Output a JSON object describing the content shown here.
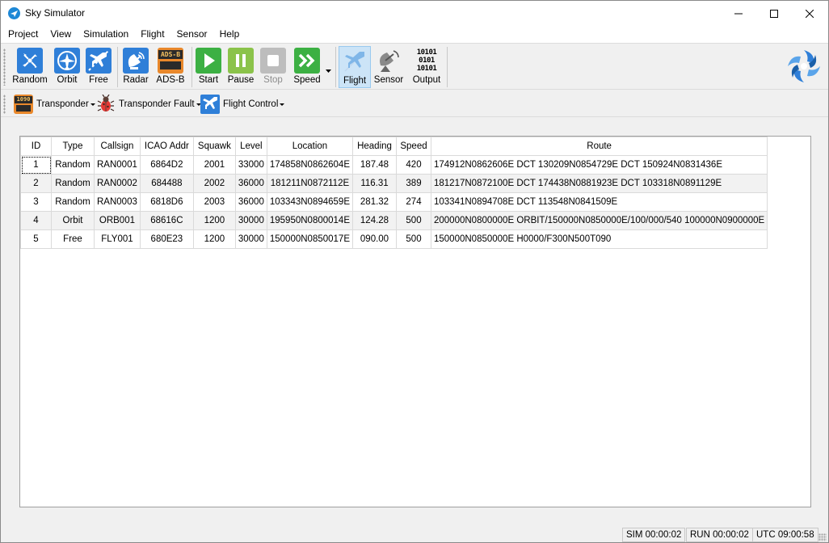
{
  "window": {
    "title": "Sky Simulator"
  },
  "menu": [
    "Project",
    "View",
    "Simulation",
    "Flight",
    "Sensor",
    "Help"
  ],
  "toolbar": {
    "random": "Random",
    "orbit": "Orbit",
    "free": "Free",
    "radar": "Radar",
    "adsb": "ADS-B",
    "adsb_icon_text": "ADS-B",
    "start": "Start",
    "pause": "Pause",
    "stop": "Stop",
    "speed": "Speed",
    "flight": "Flight",
    "sensor": "Sensor",
    "output": "Output",
    "output_icon_text": "10101\n0101\n10101"
  },
  "toolbar2": {
    "transponder": "Transponder",
    "transponder_icon_text": "1090",
    "transponder_fault": "Transponder Fault",
    "flight_control": "Flight Control"
  },
  "table": {
    "columns": [
      "ID",
      "Type",
      "Callsign",
      "ICAO Addr",
      "Squawk",
      "Level",
      "Location",
      "Heading",
      "Speed",
      "Route"
    ],
    "rows": [
      [
        "1",
        "Random",
        "RAN0001",
        "6864D2",
        "2001",
        "33000",
        "174858N0862604E",
        "187.48",
        "420",
        "174912N0862606E DCT 130209N0854729E DCT 150924N0831436E"
      ],
      [
        "2",
        "Random",
        "RAN0002",
        "684488",
        "2002",
        "36000",
        "181211N0872112E",
        "116.31",
        "389",
        "181217N0872100E DCT 174438N0881923E DCT 103318N0891129E"
      ],
      [
        "3",
        "Random",
        "RAN0003",
        "6818D6",
        "2003",
        "36000",
        "103343N0894659E",
        "281.32",
        "274",
        "103341N0894708E DCT 113548N0841509E"
      ],
      [
        "4",
        "Orbit",
        "ORB001",
        "68616C",
        "1200",
        "30000",
        "195950N0800014E",
        "124.28",
        "500",
        "200000N0800000E ORBIT/150000N0850000E/100/000/540 100000N0900000E"
      ],
      [
        "5",
        "Free",
        "FLY001",
        "680E23",
        "1200",
        "30000",
        "150000N0850017E",
        "090.00",
        "500",
        "150000N0850000E H0000/F300N500T090"
      ]
    ]
  },
  "status": {
    "sim": "SIM 00:00:02",
    "run": "RUN 00:00:02",
    "utc": "UTC 09:00:58"
  },
  "colors": {
    "accent_blue": "#2f7fd8",
    "green": "#3cb043",
    "selected_bg": "#cce4f7"
  }
}
